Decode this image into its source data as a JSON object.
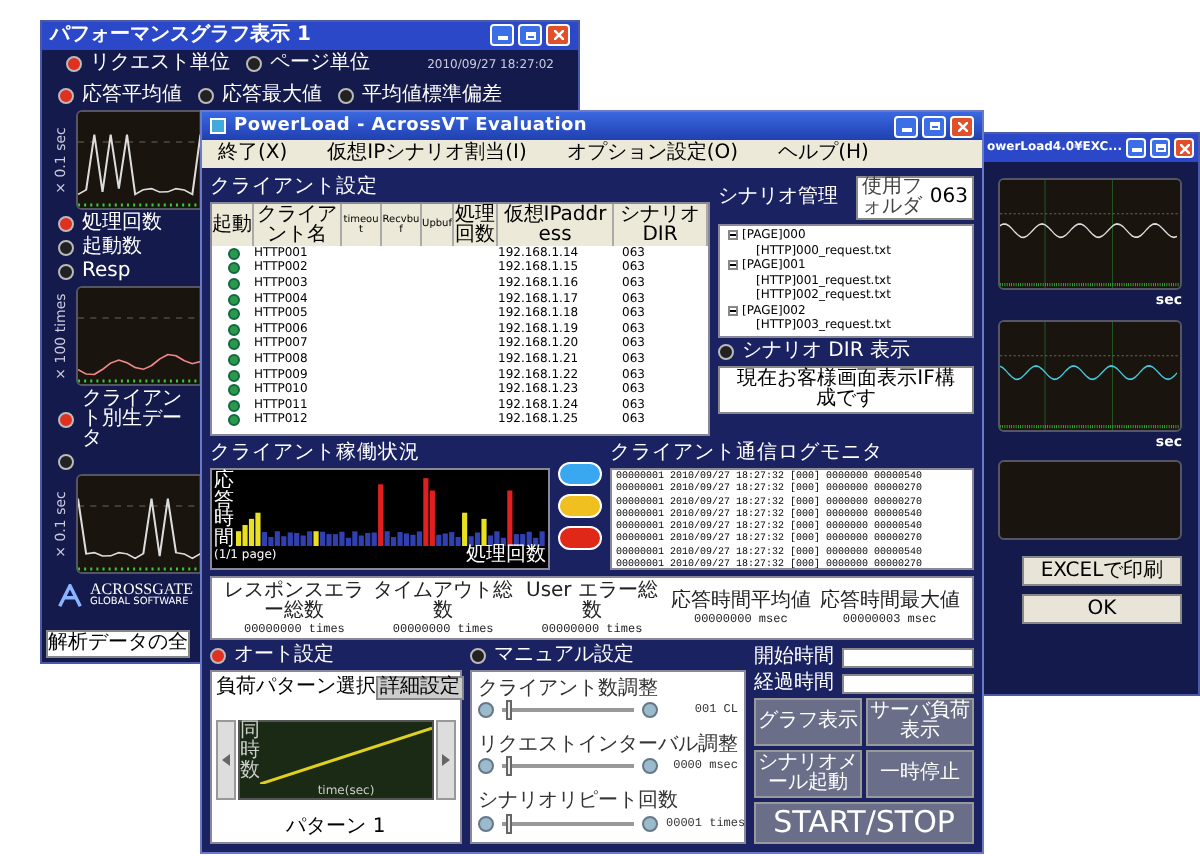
{
  "graph_window": {
    "title": "パフォーマンスグラフ表示 1",
    "unit_options": [
      {
        "label": "リクエスト単位",
        "selected": true
      },
      {
        "label": "ページ単位",
        "selected": false
      }
    ],
    "timestamp": "2010/09/27 18:27:02",
    "panels": [
      {
        "options": [
          {
            "label": "応答平均値",
            "selected": true
          },
          {
            "label": "応答最大値",
            "selected": false
          },
          {
            "label": "平均値標準偏差",
            "selected": false
          }
        ],
        "ylabel": "× 0.1 sec"
      },
      {
        "options": [
          {
            "label": "処理回数",
            "selected": true
          },
          {
            "label": "起動数",
            "selected": false
          },
          {
            "label": "Resp",
            "selected": false
          }
        ],
        "ylabel": "× 100 times"
      },
      {
        "options": [
          {
            "label": "クライアント別生データ",
            "selected": true
          },
          {
            "selected": false
          }
        ],
        "ylabel": "× 0.1 sec"
      }
    ],
    "logo": {
      "name": "ACROSSGATE",
      "tagline": "GLOBAL SOFTWARE"
    },
    "button": "解析データの全"
  },
  "excel_window": {
    "title": "owerLoad4.0¥EXC...",
    "charts": [
      {
        "unit": "sec"
      },
      {
        "unit": "sec"
      }
    ],
    "buttons": [
      "EXCELで印刷",
      "OK"
    ]
  },
  "main_window": {
    "title": "PowerLoad - AcrossVT Evaluation",
    "menu": [
      "終了(X)",
      "仮想IPシナリオ割当(I)",
      "オプション設定(O)",
      "ヘルプ(H)"
    ],
    "client_settings": {
      "title": "クライアント設定",
      "columns": [
        "起動",
        "クライアント名",
        "timeout",
        "Recvbuf",
        "Upbuf",
        "処理回数",
        "仮想IPaddress",
        "シナリオDIR"
      ],
      "rows": [
        {
          "name": "HTTP001",
          "ip": "192.168.1.14",
          "dir": "063"
        },
        {
          "name": "HTTP002",
          "ip": "192.168.1.15",
          "dir": "063"
        },
        {
          "name": "HTTP003",
          "ip": "192.168.1.16",
          "dir": "063"
        },
        {
          "name": "HTTP004",
          "ip": "192.168.1.17",
          "dir": "063"
        },
        {
          "name": "HTTP005",
          "ip": "192.168.1.18",
          "dir": "063"
        },
        {
          "name": "HTTP006",
          "ip": "192.168.1.19",
          "dir": "063"
        },
        {
          "name": "HTTP007",
          "ip": "192.168.1.20",
          "dir": "063"
        },
        {
          "name": "HTTP008",
          "ip": "192.168.1.21",
          "dir": "063"
        },
        {
          "name": "HTTP009",
          "ip": "192.168.1.22",
          "dir": "063"
        },
        {
          "name": "HTTP010",
          "ip": "192.168.1.23",
          "dir": "063"
        },
        {
          "name": "HTTP011",
          "ip": "192.168.1.24",
          "dir": "063"
        },
        {
          "name": "HTTP012",
          "ip": "192.168.1.25",
          "dir": "063"
        }
      ]
    },
    "scenario": {
      "title": "シナリオ管理",
      "folder_label": "使用フォルダ",
      "folder_value": "063",
      "tree": [
        {
          "label": "[PAGE]000",
          "expanded": true,
          "children": [
            {
              "label": "[HTTP]000_request.txt"
            }
          ]
        },
        {
          "label": "[PAGE]001",
          "expanded": true,
          "children": [
            {
              "label": "[HTTP]001_request.txt"
            },
            {
              "label": "[HTTP]002_request.txt"
            }
          ]
        },
        {
          "label": "[PAGE]002",
          "expanded": true,
          "children": [
            {
              "label": "[HTTP]003_request.txt"
            }
          ]
        }
      ],
      "dir_option": {
        "label": "シナリオ DIR 表示",
        "selected": false
      },
      "message": "現在お客様画面表示IF構成です"
    },
    "status": {
      "title": "クライアント稼働状況",
      "ylabel": "応答時間",
      "page": "(1/1 page)",
      "xlabel": "処理回数"
    },
    "status_buttons": [
      {
        "color": "#3aa8f0"
      },
      {
        "color": "#f0c020"
      },
      {
        "color": "#e02818"
      }
    ],
    "log": {
      "title": "クライアント通信ログモニタ",
      "lines": [
        "00000001 2010/09/27 18:27:32 [000] 0000000 00000540",
        "00000001 2010/09/27 18:27:32 [000] 0000000 00000270",
        "00000001 2010/09/27 18:27:32 [000] 0000000 00000270",
        "00000001 2010/09/27 18:27:32 [000] 0000000 00000540",
        "00000001 2010/09/27 18:27:32 [000] 0000000 00000540",
        "00000001 2010/09/27 18:27:32 [000] 0000000 00000270",
        "00000001 2010/09/27 18:27:32 [000] 0000000 00000540",
        "00000001 2010/09/27 18:27:32 [000] 0000000 00000270"
      ]
    },
    "stats": [
      {
        "label": "レスポンスエラー総数",
        "value": "00000000 times"
      },
      {
        "label": "タイムアウト総数",
        "value": "00000000 times"
      },
      {
        "label": "User エラー総数",
        "value": "00000000 times"
      },
      {
        "label": "応答時間平均値",
        "value": "00000000 msec"
      },
      {
        "label": "応答時間最大値",
        "value": "00000003 msec"
      }
    ],
    "auto": {
      "label": "オート設定",
      "selected": true,
      "pattern_label": "負荷パターン選択",
      "detail_button": "詳細設定",
      "chart_ylabel": "同時数",
      "chart_xlabel": "time(sec)",
      "pattern": "パターン 1"
    },
    "manual": {
      "label": "マニュアル設定",
      "selected": false,
      "sliders": [
        {
          "label": "クライアント数調整",
          "reading": "001 CL",
          "level": 0.03
        },
        {
          "label": "リクエストインターバル調整",
          "reading": "0000 msec",
          "level": 0.03
        },
        {
          "label": "シナリオリピート回数",
          "reading": "00001 times",
          "level": 0.03
        }
      ]
    },
    "times": [
      {
        "label": "開始時間"
      },
      {
        "label": "経過時間"
      }
    ],
    "buttons": [
      "グラフ表示",
      "サーバ負荷表示",
      "シナリオメール起動",
      "一時停止"
    ],
    "start_stop": "START/STOP"
  }
}
